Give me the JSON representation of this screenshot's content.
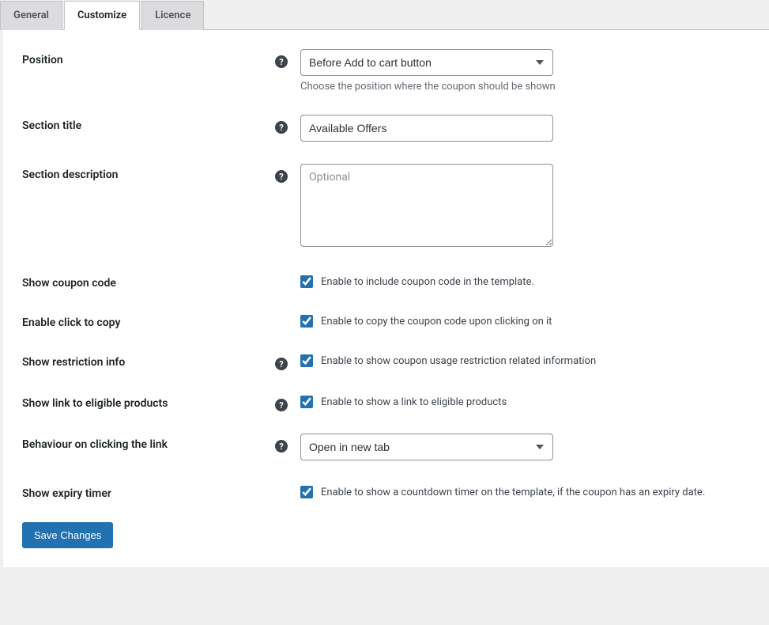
{
  "tabs": {
    "general": "General",
    "customize": "Customize",
    "licence": "Licence"
  },
  "fields": {
    "position": {
      "label": "Position",
      "value": "Before Add to cart button",
      "description": "Choose the position where the coupon should be shown"
    },
    "section_title": {
      "label": "Section title",
      "value": "Available Offers"
    },
    "section_description": {
      "label": "Section description",
      "placeholder": "Optional",
      "value": ""
    },
    "show_coupon_code": {
      "label": "Show coupon code",
      "checkbox_label": "Enable to include coupon code in the template."
    },
    "click_to_copy": {
      "label": "Enable click to copy",
      "checkbox_label": "Enable to copy the coupon code upon clicking on it"
    },
    "restriction_info": {
      "label": "Show restriction info",
      "checkbox_label": "Enable to show coupon usage restriction related information"
    },
    "eligible_products": {
      "label": "Show link to eligible products",
      "checkbox_label": "Enable to show a link to eligible products"
    },
    "link_behaviour": {
      "label": "Behaviour on clicking the link",
      "value": "Open in new tab"
    },
    "expiry_timer": {
      "label": "Show expiry timer",
      "checkbox_label": "Enable to show a countdown timer on the template, if the coupon has an expiry date."
    }
  },
  "buttons": {
    "save": "Save Changes"
  }
}
